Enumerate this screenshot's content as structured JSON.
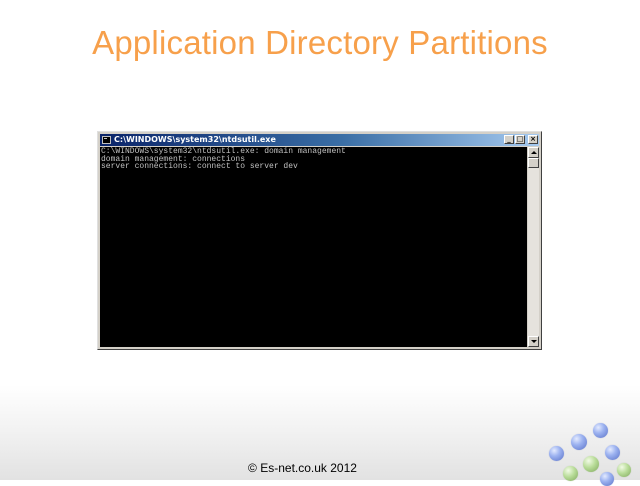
{
  "slide": {
    "title": "Application Directory Partitions",
    "footer": "© Es-net.co.uk 2012"
  },
  "console": {
    "window_title": "C:\\WINDOWS\\system32\\ntdsutil.exe",
    "controls": {
      "minimize": "_",
      "maximize": "□",
      "close": "×"
    },
    "lines": [
      "C:\\WINDOWS\\system32\\ntdsutil.exe: domain management",
      "domain management: connections",
      "server connections: connect to server dev"
    ]
  },
  "colors": {
    "title": "#f7a04b",
    "console_background": "#000000",
    "console_text": "#c0c0c0",
    "titlebar_start": "#0a246a",
    "titlebar_end": "#a6caf0"
  },
  "icons": {
    "window": "console-window-icon",
    "scroll_up": "triangle-up",
    "scroll_down": "triangle-down"
  }
}
